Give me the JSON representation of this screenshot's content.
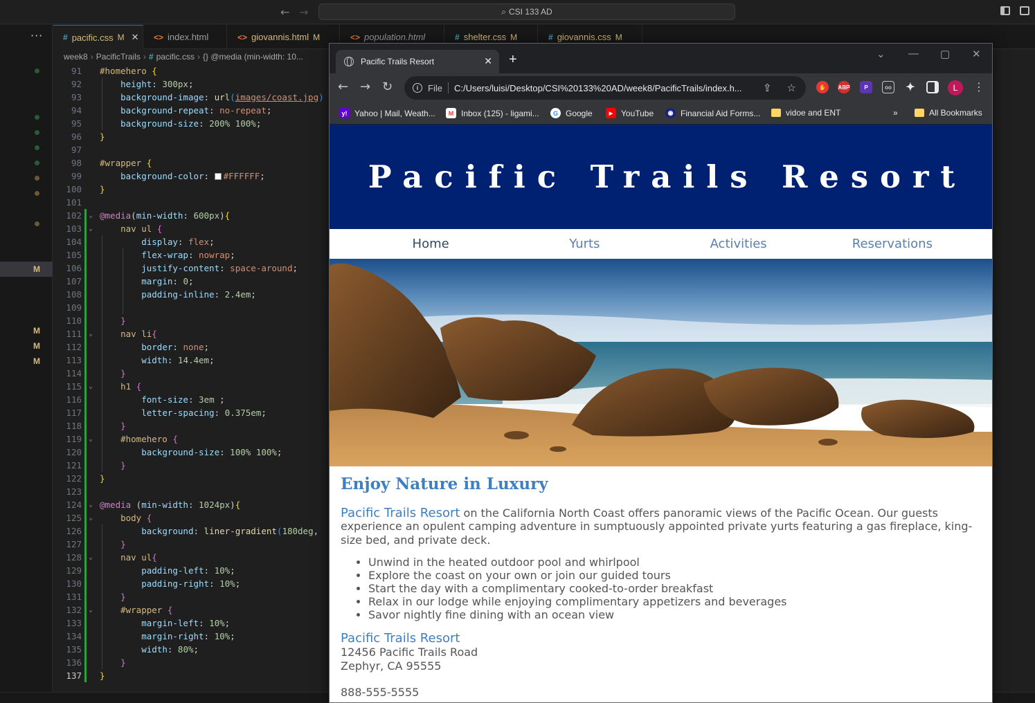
{
  "vscode": {
    "command_center": "CSI 133 AD",
    "tabs": [
      {
        "name": "pacific.css",
        "mod": "M",
        "type": "css",
        "active": true
      },
      {
        "name": "index.html",
        "mod": "",
        "type": "html"
      },
      {
        "name": "giovannis.html",
        "mod": "M",
        "type": "html"
      },
      {
        "name": "population.html",
        "mod": "",
        "type": "html"
      },
      {
        "name": "shelter.css",
        "mod": "M",
        "type": "css"
      },
      {
        "name": "giovannis.css",
        "mod": "M",
        "type": "css"
      }
    ],
    "breadcrumb": [
      "week8",
      "PacificTrails",
      "pacific.css",
      "{} @media (min-width: 10..."
    ],
    "scm_marks": [
      "M",
      "M",
      "M",
      "M"
    ],
    "code_lines": [
      {
        "n": 91,
        "text": "#homehero {"
      },
      {
        "n": 92,
        "text": "    height: 300px;"
      },
      {
        "n": 93,
        "text": "    background-image: url(images/coast.jpg)"
      },
      {
        "n": 94,
        "text": "    background-repeat: no-repeat;"
      },
      {
        "n": 95,
        "text": "    background-size: 200% 100%;"
      },
      {
        "n": 96,
        "text": "}"
      },
      {
        "n": 97,
        "text": ""
      },
      {
        "n": 98,
        "text": "#wrapper {"
      },
      {
        "n": 99,
        "text": "    background-color: #FFFFFF;"
      },
      {
        "n": 100,
        "text": "}"
      },
      {
        "n": 101,
        "text": ""
      },
      {
        "n": 102,
        "text": "@media(min-width: 600px){"
      },
      {
        "n": 103,
        "text": "    nav ul {"
      },
      {
        "n": 104,
        "text": "        display: flex;"
      },
      {
        "n": 105,
        "text": "        flex-wrap: nowrap;"
      },
      {
        "n": 106,
        "text": "        justify-content: space-around;"
      },
      {
        "n": 107,
        "text": "        margin: 0;"
      },
      {
        "n": 108,
        "text": "        padding-inline: 2.4em;"
      },
      {
        "n": 109,
        "text": ""
      },
      {
        "n": 110,
        "text": "    }"
      },
      {
        "n": 111,
        "text": "    nav li{"
      },
      {
        "n": 112,
        "text": "        border: none;"
      },
      {
        "n": 113,
        "text": "        width: 14.4em;"
      },
      {
        "n": 114,
        "text": "    }"
      },
      {
        "n": 115,
        "text": "    h1 {"
      },
      {
        "n": 116,
        "text": "        font-size: 3em ;"
      },
      {
        "n": 117,
        "text": "        letter-spacing: 0.375em;"
      },
      {
        "n": 118,
        "text": "    }"
      },
      {
        "n": 119,
        "text": "    #homehero {"
      },
      {
        "n": 120,
        "text": "        background-size: 100% 100%;"
      },
      {
        "n": 121,
        "text": "    }"
      },
      {
        "n": 122,
        "text": "}"
      },
      {
        "n": 123,
        "text": ""
      },
      {
        "n": 124,
        "text": "@media (min-width: 1024px){"
      },
      {
        "n": 125,
        "text": "    body {"
      },
      {
        "n": 126,
        "text": "        background: liner-gradient(180deg,"
      },
      {
        "n": 127,
        "text": "    }"
      },
      {
        "n": 128,
        "text": "    nav ul{"
      },
      {
        "n": 129,
        "text": "        padding-left: 10%;"
      },
      {
        "n": 130,
        "text": "        padding-right: 10%;"
      },
      {
        "n": 131,
        "text": "    }"
      },
      {
        "n": 132,
        "text": "    #wrapper {"
      },
      {
        "n": 133,
        "text": "        margin-left: 10%;"
      },
      {
        "n": 134,
        "text": "        margin-right: 10%;"
      },
      {
        "n": 135,
        "text": "        width: 80%;"
      },
      {
        "n": 136,
        "text": "    }"
      },
      {
        "n": 137,
        "text": "}"
      }
    ]
  },
  "browser": {
    "tab_title": "Pacific Trails Resort",
    "scheme_label": "File",
    "url": "C:/Users/luisi/Desktop/CSI%20133%20AD/week8/PacificTrails/index.h...",
    "profile_initial": "L",
    "bookmarks": [
      {
        "label": "Yahoo | Mail, Weath...",
        "icon": "yahoo-icon"
      },
      {
        "label": "Inbox (125) - ligami...",
        "icon": "gmail-icon"
      },
      {
        "label": "Google",
        "icon": "google-icon"
      },
      {
        "label": "YouTube",
        "icon": "youtube-icon"
      },
      {
        "label": "Financial Aid Forms...",
        "icon": "globe-icon"
      },
      {
        "label": "vidoe and ENT",
        "icon": "folder-icon"
      }
    ],
    "bookmarks_overflow": "»",
    "all_bookmarks": "All Bookmarks",
    "ext_abp": "ABP"
  },
  "page": {
    "header_title": "Pacific Trails Resort",
    "nav": [
      "Home",
      "Yurts",
      "Activities",
      "Reservations"
    ],
    "heading": "Enjoy Nature in Luxury",
    "intro_strong": "Pacific Trails Resort",
    "intro_rest": " on the California North Coast offers panoramic views of the Pacific Ocean. Our guests experience an opulent camping adventure in sumptuously appointed private yurts featuring a gas fireplace, king-size bed, and private deck.",
    "features": [
      "Unwind in the heated outdoor pool and whirlpool",
      "Explore the coast on your own or join our guided tours",
      "Start the day with a complimentary cooked-to-order breakfast",
      "Relax in our lodge while enjoying complimentary appetizers and beverages",
      "Savor nightly fine dining with an ocean view"
    ],
    "address_name": "Pacific Trails Resort",
    "address_line1": "12456 Pacific Trails Road",
    "address_line2": "Zephyr, CA 95555",
    "phone": "888-555-5555"
  }
}
